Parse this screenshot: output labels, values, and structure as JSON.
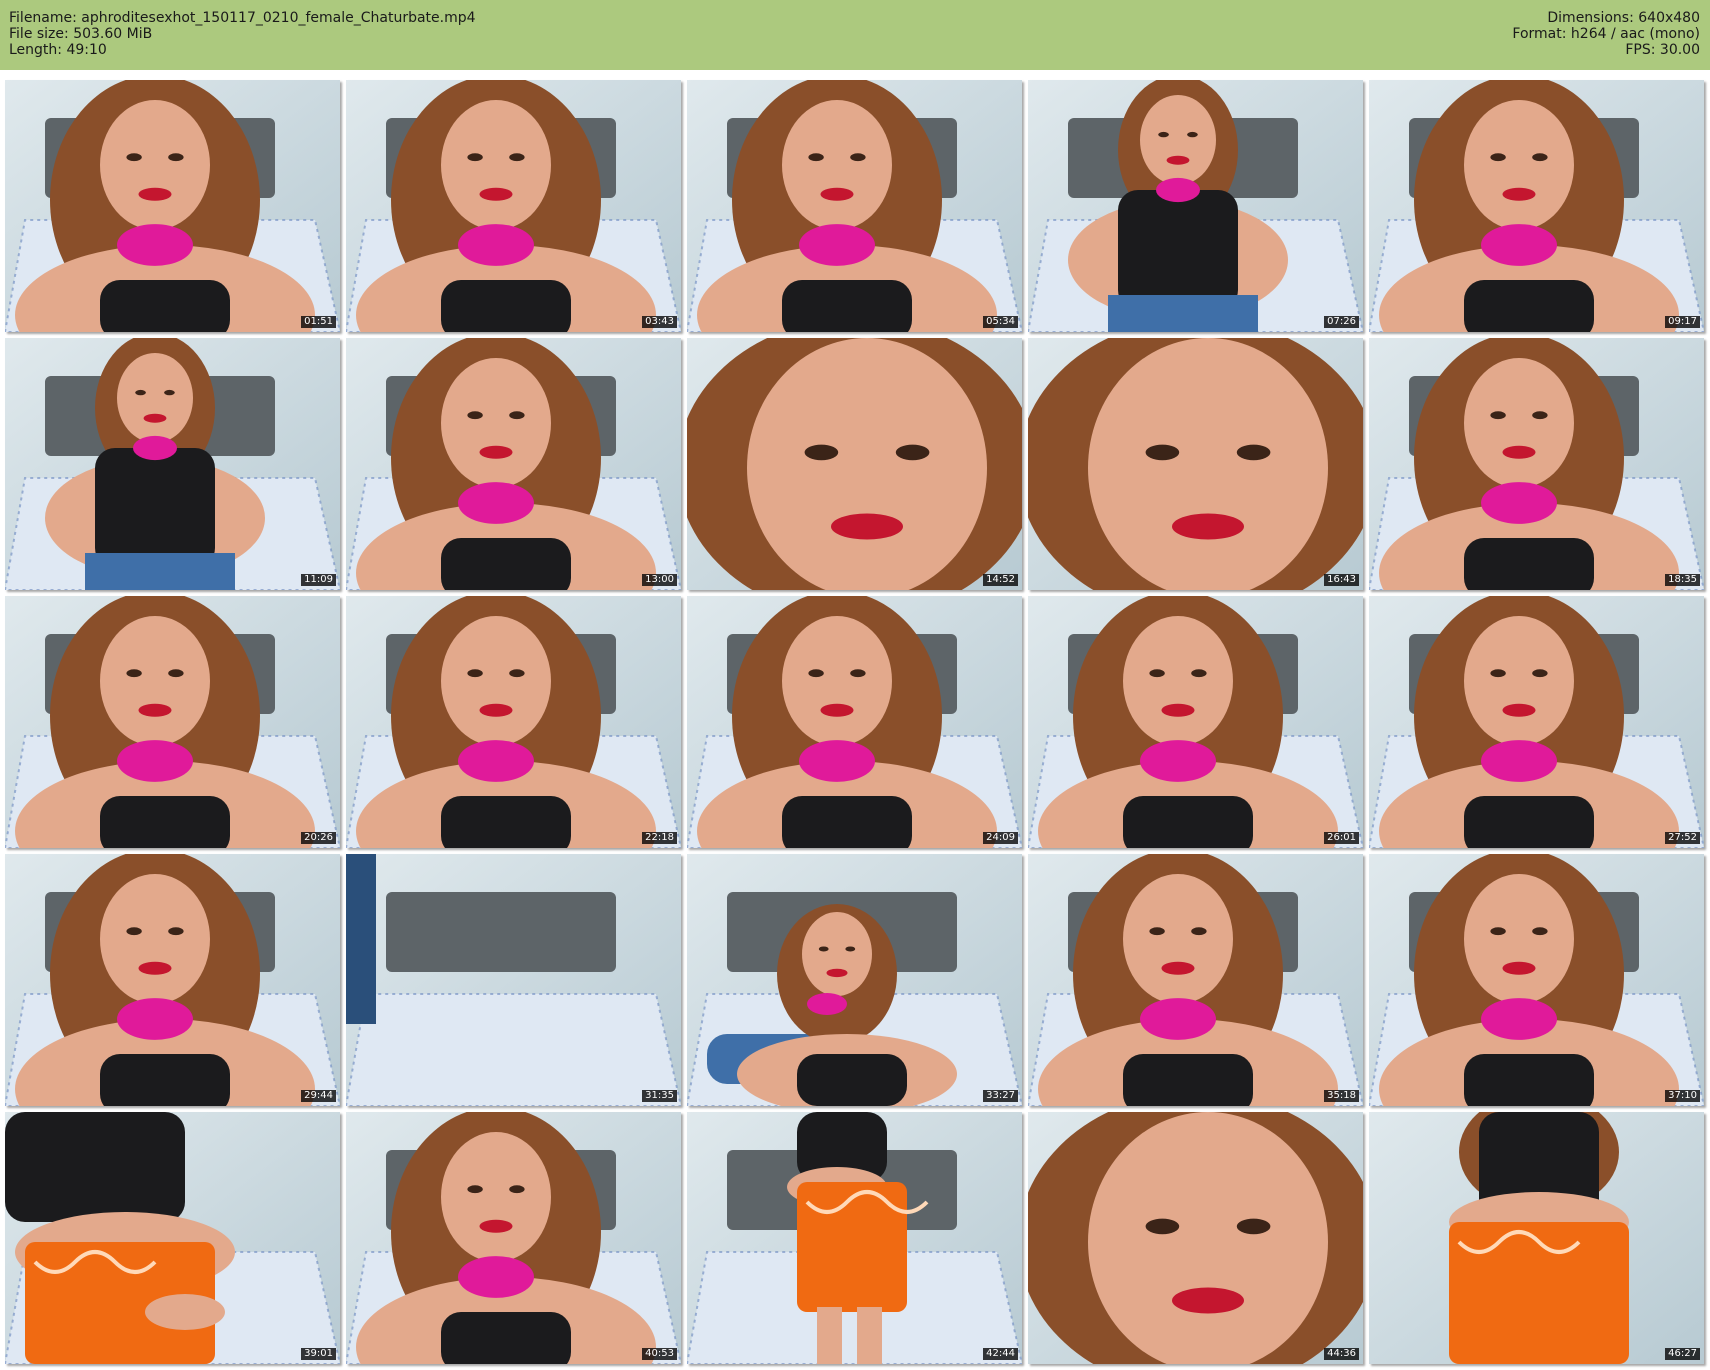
{
  "header": {
    "filename": "Filename: aphroditesexhot_150117_0210_female_Chaturbate.mp4",
    "file_size": "File size: 503.60 MiB",
    "length": "Length: 49:10",
    "dimensions": "Dimensions: 640x480",
    "format": "Format: h264 / aac (mono)",
    "fps": "FPS: 30.00"
  },
  "colors": {
    "header_bg": "#acc97e",
    "timestamp_bg": "#000000",
    "timestamp_text": "#ffffff"
  },
  "thumbnails": [
    {
      "time": "01:51",
      "scene": "closeup"
    },
    {
      "time": "03:43",
      "scene": "closeup"
    },
    {
      "time": "05:34",
      "scene": "closeup"
    },
    {
      "time": "07:26",
      "scene": "seated"
    },
    {
      "time": "09:17",
      "scene": "closeup"
    },
    {
      "time": "11:09",
      "scene": "seated"
    },
    {
      "time": "13:00",
      "scene": "closeup"
    },
    {
      "time": "14:52",
      "scene": "face"
    },
    {
      "time": "16:43",
      "scene": "face"
    },
    {
      "time": "18:35",
      "scene": "closeup"
    },
    {
      "time": "20:26",
      "scene": "closeup"
    },
    {
      "time": "22:18",
      "scene": "closeup"
    },
    {
      "time": "24:09",
      "scene": "closeup"
    },
    {
      "time": "26:01",
      "scene": "closeup"
    },
    {
      "time": "27:52",
      "scene": "closeup"
    },
    {
      "time": "29:44",
      "scene": "closeup"
    },
    {
      "time": "31:35",
      "scene": "empty"
    },
    {
      "time": "33:27",
      "scene": "lying"
    },
    {
      "time": "35:18",
      "scene": "closeup"
    },
    {
      "time": "37:10",
      "scene": "closeup"
    },
    {
      "time": "39:01",
      "scene": "wrap"
    },
    {
      "time": "40:53",
      "scene": "closeup"
    },
    {
      "time": "42:44",
      "scene": "standing"
    },
    {
      "time": "44:36",
      "scene": "face"
    },
    {
      "time": "46:27",
      "scene": "back"
    }
  ]
}
